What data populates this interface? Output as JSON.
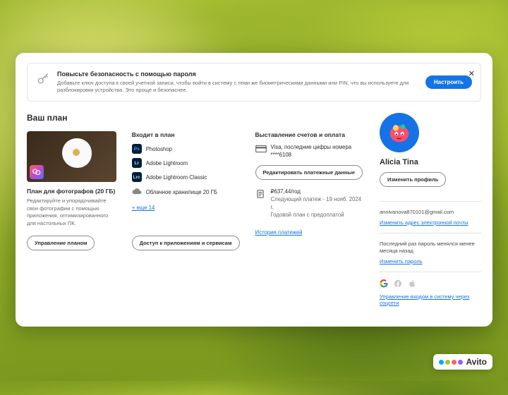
{
  "banner": {
    "title": "Повысьте безопасность с помощью пароля",
    "desc": "Добавьте ключ доступа к своей учетной записи, чтобы войти в систему с теми же биометрическими данными или PIN, что вы используете для разблокировки устройства. Это проще и безопаснее.",
    "button": "Настроить"
  },
  "plan": {
    "sectionTitle": "Ваш план",
    "name": "План для фотографов (20 ГБ)",
    "desc": "Редактируйте и упорядочивайте свои фотографии с помощью приложения, оптимизированного для настольных ПК.",
    "manageBtn": "Управление планом"
  },
  "included": {
    "title": "Входит в план",
    "apps": [
      {
        "abbr": "Ps",
        "name": "Photoshop",
        "cls": "ps"
      },
      {
        "abbr": "Lr",
        "name": "Adobe Lightroom",
        "cls": "lr"
      },
      {
        "abbr": "Lrc",
        "name": "Adobe Lightroom Classic",
        "cls": "lrc"
      }
    ],
    "storage": "Облачное хранилище 20 ГБ",
    "moreLink": "+ еще 14",
    "accessBtn": "Доступ к приложениям и сервисам"
  },
  "billing": {
    "title": "Выставление счетов и оплата",
    "card": "Visa, последние цифры номера ****6108",
    "editBtn": "Редактировать платежные данные",
    "price": "₽637,44/год",
    "next": "Следующий платеж - 19 нояб. 2024 г.",
    "planType": "Годовой план с предоплатой",
    "historyLink": "История платежей"
  },
  "user": {
    "name": "Alicia Tina",
    "editProfileBtn": "Изменить профиль",
    "email": "annivanova870101@gmail.com",
    "changeEmailLink": "Изменить адрес электронной почты",
    "pwdInfo": "Последний раз пароль менялся менее месяца назад",
    "changePwdLink": "Изменить пароль",
    "socialLink": "Управление входом в систему через соцсети"
  },
  "watermark": "Avito"
}
